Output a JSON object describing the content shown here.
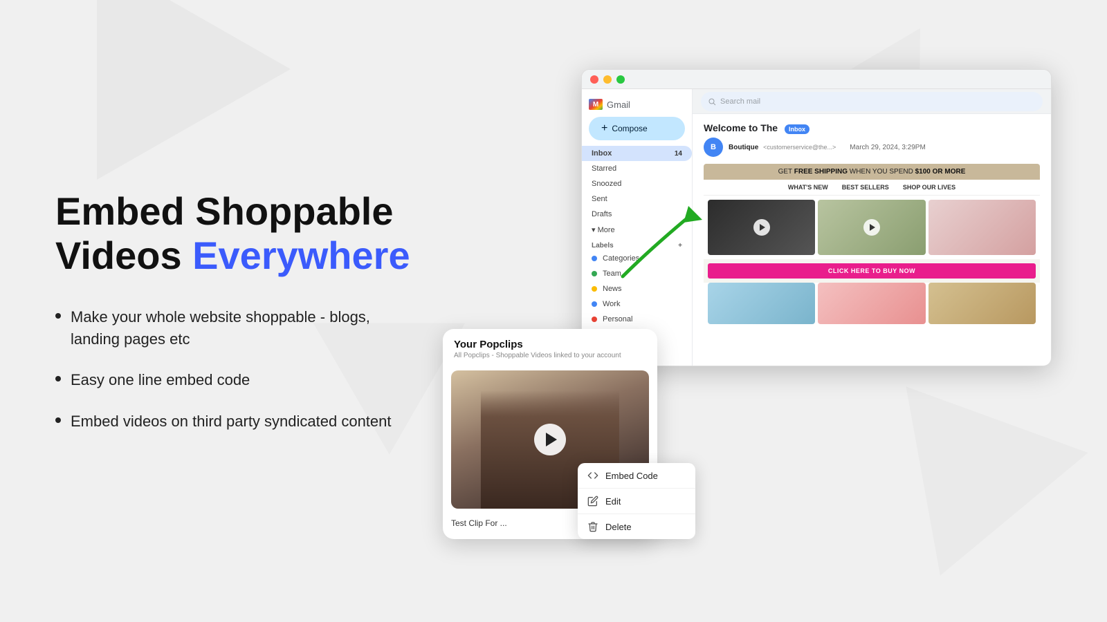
{
  "background": {
    "color": "#eeeeee"
  },
  "headline": {
    "part1": "Embed Shoppable",
    "part2": "Videos ",
    "part3": "Everywhere"
  },
  "bullets": [
    {
      "text": "Make your whole website shoppable - blogs, landing pages etc"
    },
    {
      "text": "Easy one line embed code"
    },
    {
      "text": "Embed videos on third party syndicated content"
    }
  ],
  "gmail": {
    "search_placeholder": "Search mail",
    "compose_label": "Compose",
    "nav_items": [
      {
        "label": "Inbox",
        "badge": "14",
        "active": true
      },
      {
        "label": "Starred",
        "badge": "",
        "active": false
      },
      {
        "label": "Snoozed",
        "badge": "",
        "active": false
      },
      {
        "label": "Sent",
        "badge": "",
        "active": false
      },
      {
        "label": "Drafts",
        "badge": "",
        "active": false
      },
      {
        "label": "More",
        "badge": "",
        "active": false
      }
    ],
    "labels_title": "Labels",
    "labels": [
      {
        "label": "Categories",
        "color": "#4285f4"
      },
      {
        "label": "Team",
        "color": "#34a853"
      },
      {
        "label": "News",
        "color": "#fbbc04"
      },
      {
        "label": "Work",
        "color": "#4285f4"
      },
      {
        "label": "Personal",
        "color": "#ea4335"
      }
    ],
    "email": {
      "subject": "Welcome to The",
      "inbox_badge": "Inbox",
      "from": "Boutique",
      "date": "March 29, 2024, 3:29PM",
      "banner_text": "GET FREE SHIPPING WHEN YOU SPEND $100 OR MORE",
      "nav": [
        "WHAT'S NEW",
        "BEST SELLERS",
        "SHOP OUR LIVES"
      ],
      "buy_btn": "CLICK HERE TO BUY NOW"
    }
  },
  "popclips": {
    "title": "Your Popclips",
    "subtitle": "All Popclips - Shoppable Videos linked to your account",
    "clip_name": "Test Clip For ...",
    "more_btn_label": "..."
  },
  "context_menu": {
    "items": [
      {
        "icon": "code-icon",
        "label": "Embed Code"
      },
      {
        "icon": "edit-icon",
        "label": "Edit"
      },
      {
        "icon": "delete-icon",
        "label": "Delete"
      }
    ]
  }
}
